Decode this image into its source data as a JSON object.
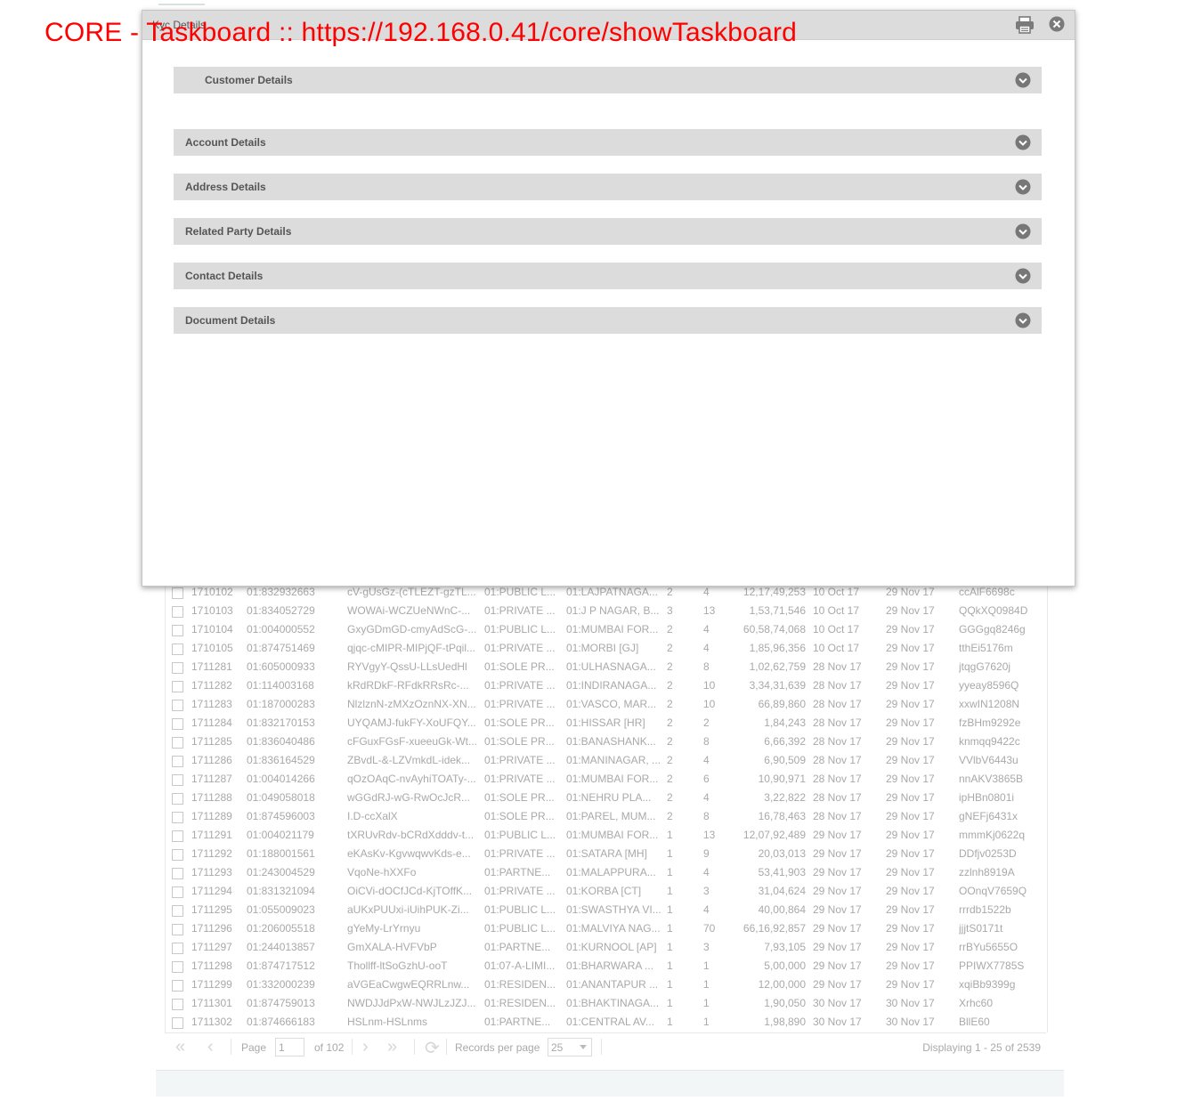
{
  "banner": "CORE - Taskboard :: https://192.168.0.41/core/showTaskboard",
  "modal": {
    "title": "Kyc Details",
    "sections": [
      {
        "label": "Customer Details"
      },
      {
        "label": "Account Details"
      },
      {
        "label": "Address Details"
      },
      {
        "label": "Related Party Details"
      },
      {
        "label": "Contact Details"
      },
      {
        "label": "Document Details"
      }
    ]
  },
  "grid": {
    "rows": [
      [
        "1710102",
        "01:832932663",
        "cV-gUsGz-(cTLEZT-gzTL...",
        "01:PUBLIC L...",
        "01:LAJPATNAGA...",
        "2",
        "4",
        "12,17,49,253",
        "10 Oct 17",
        "29 Nov 17",
        "ccAlF6698c"
      ],
      [
        "1710103",
        "01:834052729",
        "WOWAi-WCZUeNWnC-...",
        "01:PRIVATE ...",
        "01:J P NAGAR, B...",
        "3",
        "13",
        "1,53,71,546",
        "10 Oct 17",
        "29 Nov 17",
        "QQkXQ0984D"
      ],
      [
        "1710104",
        "01:004000552",
        "GxyGDmGD-cmyAdScG-...",
        "01:PUBLIC L...",
        "01:MUMBAI FOR...",
        "2",
        "4",
        "60,58,74,068",
        "10 Oct 17",
        "29 Nov 17",
        "GGGgq8246g"
      ],
      [
        "1710105",
        "01:874751469",
        "qjqc-cMIPR-MIPjQF-tPqil...",
        "01:PRIVATE ...",
        "01:MORBI [GJ]",
        "2",
        "4",
        "1,85,96,356",
        "10 Oct 17",
        "29 Nov 17",
        "tthEi5176m"
      ],
      [
        "1711281",
        "01:605000933",
        "RYVgyY-QssU-LLsUedHl",
        "01:SOLE PR...",
        "01:ULHASNAGA...",
        "2",
        "8",
        "1,02,62,759",
        "28 Nov 17",
        "29 Nov 17",
        "jtqgG7620j"
      ],
      [
        "1711282",
        "01:114003168",
        "kRdRDkF-RFdkRRsRc-...",
        "01:PRIVATE ...",
        "01:INDIRANAGA...",
        "2",
        "10",
        "3,34,31,639",
        "28 Nov 17",
        "29 Nov 17",
        "yyeay8596Q"
      ],
      [
        "1711283",
        "01:187000283",
        "NlzlznN-zMXzOznNX-XN...",
        "01:PRIVATE ...",
        "01:VASCO, MAR...",
        "2",
        "10",
        "66,89,860",
        "28 Nov 17",
        "29 Nov 17",
        "xxwIN1208N"
      ],
      [
        "1711284",
        "01:832170153",
        "UYQAMJ-fukFY-XoUFQY...",
        "01:SOLE PR...",
        "01:HISSAR [HR]",
        "2",
        "2",
        "1,84,243",
        "28 Nov 17",
        "29 Nov 17",
        "fzBHm9292e"
      ],
      [
        "1711285",
        "01:836040486",
        "cFGuxFGsF-xueeuGk-Wt...",
        "01:SOLE PR...",
        "01:BANASHANK...",
        "2",
        "8",
        "6,66,392",
        "28 Nov 17",
        "29 Nov 17",
        "knmqq9422c"
      ],
      [
        "1711286",
        "01:836164529",
        "ZBvdL-&-LZVmkdL-idek...",
        "01:PRIVATE ...",
        "01:MANINAGAR, ...",
        "2",
        "4",
        "6,90,509",
        "28 Nov 17",
        "29 Nov 17",
        "VVlbV6443u"
      ],
      [
        "1711287",
        "01:004014266",
        "qOzOAqC-nvAyhiTOATy-...",
        "01:PRIVATE ...",
        "01:MUMBAI FOR...",
        "2",
        "6",
        "10,90,971",
        "28 Nov 17",
        "29 Nov 17",
        "nnAKV3865B"
      ],
      [
        "1711288",
        "01:049058018",
        "wGGdRJ-wG-RwOcJcR...",
        "01:SOLE PR...",
        "01:NEHRU PLA...",
        "2",
        "4",
        "3,22,822",
        "28 Nov 17",
        "29 Nov 17",
        "ipHBn0801i"
      ],
      [
        "1711289",
        "01:874596003",
        "I.D-ccXalX",
        "01:SOLE PR...",
        "01:PAREL, MUM...",
        "2",
        "8",
        "16,78,463",
        "28 Nov 17",
        "29 Nov 17",
        "gNEFj6431x"
      ],
      [
        "1711291",
        "01:004021179",
        "tXRUvRdv-bCRdXdddv-t...",
        "01:PUBLIC L...",
        "01:MUMBAI FOR...",
        "1",
        "13",
        "12,07,92,489",
        "29 Nov 17",
        "29 Nov 17",
        "mmmKj0622q"
      ],
      [
        "1711292",
        "01:188001561",
        "eKAsKv-KgvwqwvKds-e...",
        "01:PRIVATE ...",
        "01:SATARA [MH]",
        "1",
        "9",
        "20,03,013",
        "29 Nov 17",
        "29 Nov 17",
        "DDfjv0253D"
      ],
      [
        "1711293",
        "01:243004529",
        "VqoNe-hXXFo",
        "01:PARTNE...",
        "01:MALAPPURA...",
        "1",
        "4",
        "53,41,903",
        "29 Nov 17",
        "29 Nov 17",
        "zzlnh8919A"
      ],
      [
        "1711294",
        "01:831321094",
        "OiCVi-dOCfJCd-KjTOffK...",
        "01:PRIVATE ...",
        "01:KORBA [CT]",
        "1",
        "3",
        "31,04,624",
        "29 Nov 17",
        "29 Nov 17",
        "OOnqV7659Q"
      ],
      [
        "1711295",
        "01:055009023",
        "aUKxPUUxi-iUihPUK-Zi...",
        "01:PUBLIC L...",
        "01:SWASTHYA VI...",
        "1",
        "4",
        "40,00,864",
        "29 Nov 17",
        "29 Nov 17",
        "rrrdb1522b"
      ],
      [
        "1711296",
        "01:206005518",
        "gYeMy-LrYrnyu",
        "01:PUBLIC L...",
        "01:MALVIYA NAG...",
        "1",
        "70",
        "66,16,92,857",
        "29 Nov 17",
        "29 Nov 17",
        "jjjtS0171t"
      ],
      [
        "1711297",
        "01:244013857",
        "GmXALA-HVFVbP",
        "01:PARTNE...",
        "01:KURNOOL [AP]",
        "1",
        "3",
        "7,93,105",
        "29 Nov 17",
        "29 Nov 17",
        "rrBYu5655O"
      ],
      [
        "1711298",
        "01:874717512",
        "Thollff-ltSoGzhU-ooT",
        "01:07-A-LIMI...",
        "01:BHARWARA ...",
        "1",
        "1",
        "5,00,000",
        "29 Nov 17",
        "29 Nov 17",
        "PPIWX7785S"
      ],
      [
        "1711299",
        "01:332000239",
        "aVGEaCwgwEQRRLnw...",
        "01:RESIDEN...",
        "01:ANANTAPUR ...",
        "1",
        "1",
        "12,00,000",
        "29 Nov 17",
        "29 Nov 17",
        "xqiBb9399g"
      ],
      [
        "1711301",
        "01:874759013",
        "NWDJJdPxW-NWJLzJZJ...",
        "01:RESIDEN...",
        "01:BHAKTINAGA...",
        "1",
        "1",
        "1,90,050",
        "30 Nov 17",
        "30 Nov 17",
        "Xrhc60"
      ],
      [
        "1711302",
        "01:874666183",
        "HSLnm-HSLnms",
        "01:PARTNE...",
        "01:CENTRAL AV...",
        "1",
        "1",
        "1,98,890",
        "30 Nov 17",
        "30 Nov 17",
        "BllE60"
      ]
    ]
  },
  "pager": {
    "page_label": "Page",
    "page_value": "1",
    "of_label": "of 102",
    "rpp_label": "Records per page",
    "rpp_value": "25",
    "display": "Displaying 1 - 25 of 2539"
  }
}
